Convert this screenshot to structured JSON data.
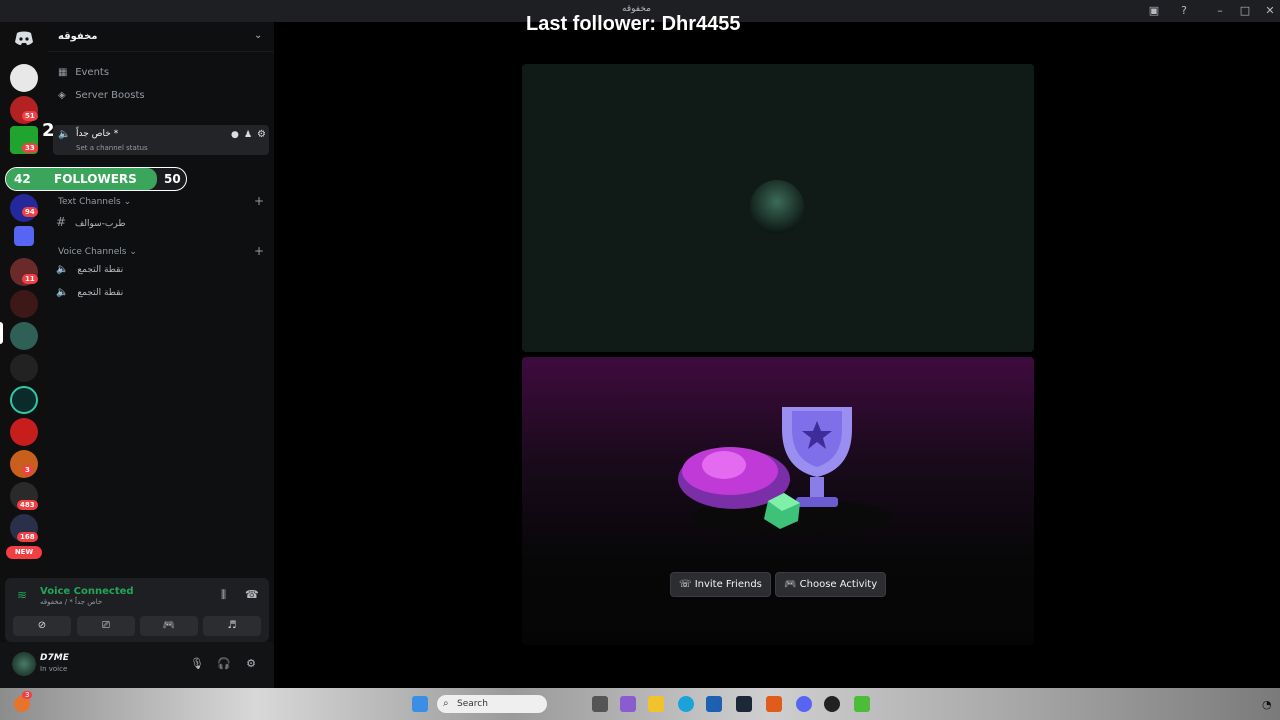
{
  "window": {
    "title": "مخفوقه",
    "controls": {
      "minimize": "–",
      "maximize": "□",
      "close": "✕"
    }
  },
  "server": {
    "name": "مخفوقه",
    "nav": {
      "events": "Events",
      "boosts": "Server Boosts"
    }
  },
  "active_voice": {
    "name": "خاص جداً *",
    "status_hint": "Set a channel status",
    "member_count": "2"
  },
  "rail_badges": {
    "b1": "51",
    "b2": "33",
    "b3": "94",
    "b4": "11",
    "b5": "3",
    "b6": "483",
    "b7": "168",
    "new": "NEW"
  },
  "followers_widget": {
    "current": "42",
    "label": "FOLLOWERS",
    "goal": "50",
    "progress": 0.84
  },
  "categories": {
    "text": "Text Channels",
    "voice": "Voice Channels"
  },
  "text_channels": [
    "طرب-سوالف"
  ],
  "voice_channels": [
    "نقطة التجمع",
    "نقطة التجمع"
  ],
  "voice_panel": {
    "title": "Voice Connected",
    "subtitle": "خاص جداً * / مخفوقه"
  },
  "user": {
    "name": "D7ME",
    "status": "In voice"
  },
  "main": {
    "title": "Last follower: Dhr4455",
    "invite_label": "Invite Friends",
    "activity_label": "Choose Activity"
  },
  "taskbar": {
    "search_placeholder": "Search",
    "notif_count": "3"
  },
  "colors": {
    "accent_green": "#23a55a",
    "badge_red": "#f23f43",
    "follower_bar": "#3ba55c",
    "activity_purple": "#3f0b3f"
  }
}
